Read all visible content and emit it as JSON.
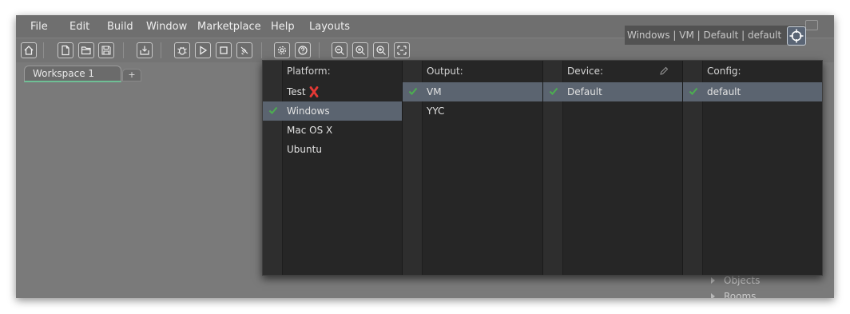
{
  "menu": [
    "File",
    "Edit",
    "Build",
    "Window",
    "Marketplace",
    "Help",
    "Layouts"
  ],
  "toolbar": {
    "icons": [
      "home-icon",
      "new-file-icon",
      "open-folder-icon",
      "save-icon",
      "package-icon",
      "debug-icon",
      "play-icon",
      "stop-icon",
      "clean-icon",
      "settings-icon",
      "help-icon",
      "zoom-out-icon",
      "zoom-reset-icon",
      "zoom-in-icon",
      "fit-icon"
    ]
  },
  "target": {
    "text": "Windows  |  VM  |  Default  |  default",
    "button_icon": "crosshair-icon"
  },
  "workspace": {
    "tab_label": "Workspace 1",
    "add_label": "+"
  },
  "asset_tree": {
    "items": [
      "Objects",
      "Rooms"
    ]
  },
  "target_popup": {
    "platform": {
      "header": "Platform:",
      "rows": [
        "Test",
        "Windows",
        "Mac OS X",
        "Ubuntu"
      ],
      "selected": "Windows",
      "error_row": "Test"
    },
    "output": {
      "header": "Output:",
      "rows": [
        "VM",
        "YYC"
      ],
      "selected": "VM"
    },
    "device": {
      "header": "Device:",
      "rows": [
        "Default"
      ],
      "selected": "Default"
    },
    "config": {
      "header": "Config:",
      "rows": [
        "default"
      ],
      "selected": "default"
    }
  },
  "colors": {
    "accent_check": "#4caf50",
    "error_x": "#e53935",
    "selection": "#5b6470",
    "tab_underline": "#6fbf95"
  }
}
